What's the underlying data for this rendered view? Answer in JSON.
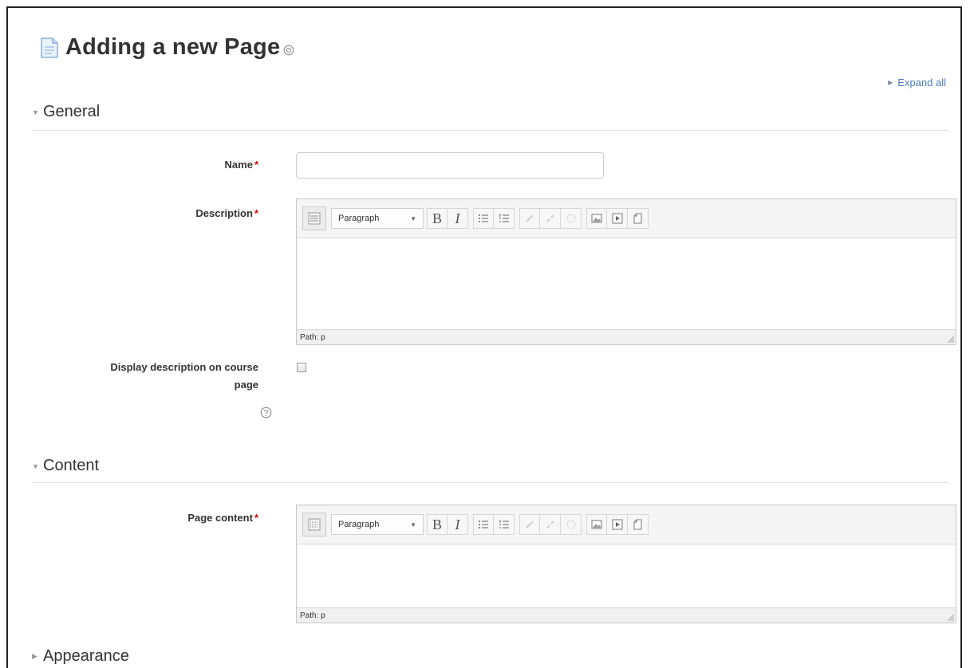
{
  "page": {
    "title": "Adding a new Page",
    "expand_all": "Expand all"
  },
  "sections": {
    "general": "General",
    "content": "Content",
    "appearance": "Appearance"
  },
  "fields": {
    "name_label": "Name",
    "name_value": "",
    "description_label": "Description",
    "display_description_label_line1": "Display description on course",
    "display_description_label_line2": "page",
    "display_description_checked": false,
    "page_content_label": "Page content",
    "required_mark": "*"
  },
  "editor": {
    "format_select": "Paragraph",
    "bold": "B",
    "italic": "I",
    "path_text": "Path: p"
  },
  "icons": {
    "page": "page-icon",
    "help": "help-icon",
    "kitchen_sink": "toolbar-toggle-icon",
    "unordered_list": "unordered-list-icon",
    "ordered_list": "ordered-list-icon",
    "link": "link-icon",
    "unlink": "unlink-icon",
    "emoticon": "emoticon-icon",
    "image": "image-icon",
    "media": "media-icon",
    "manage_files": "manage-files-icon"
  },
  "colors": {
    "required": "#dd0000",
    "link": "#4a7ab5"
  }
}
